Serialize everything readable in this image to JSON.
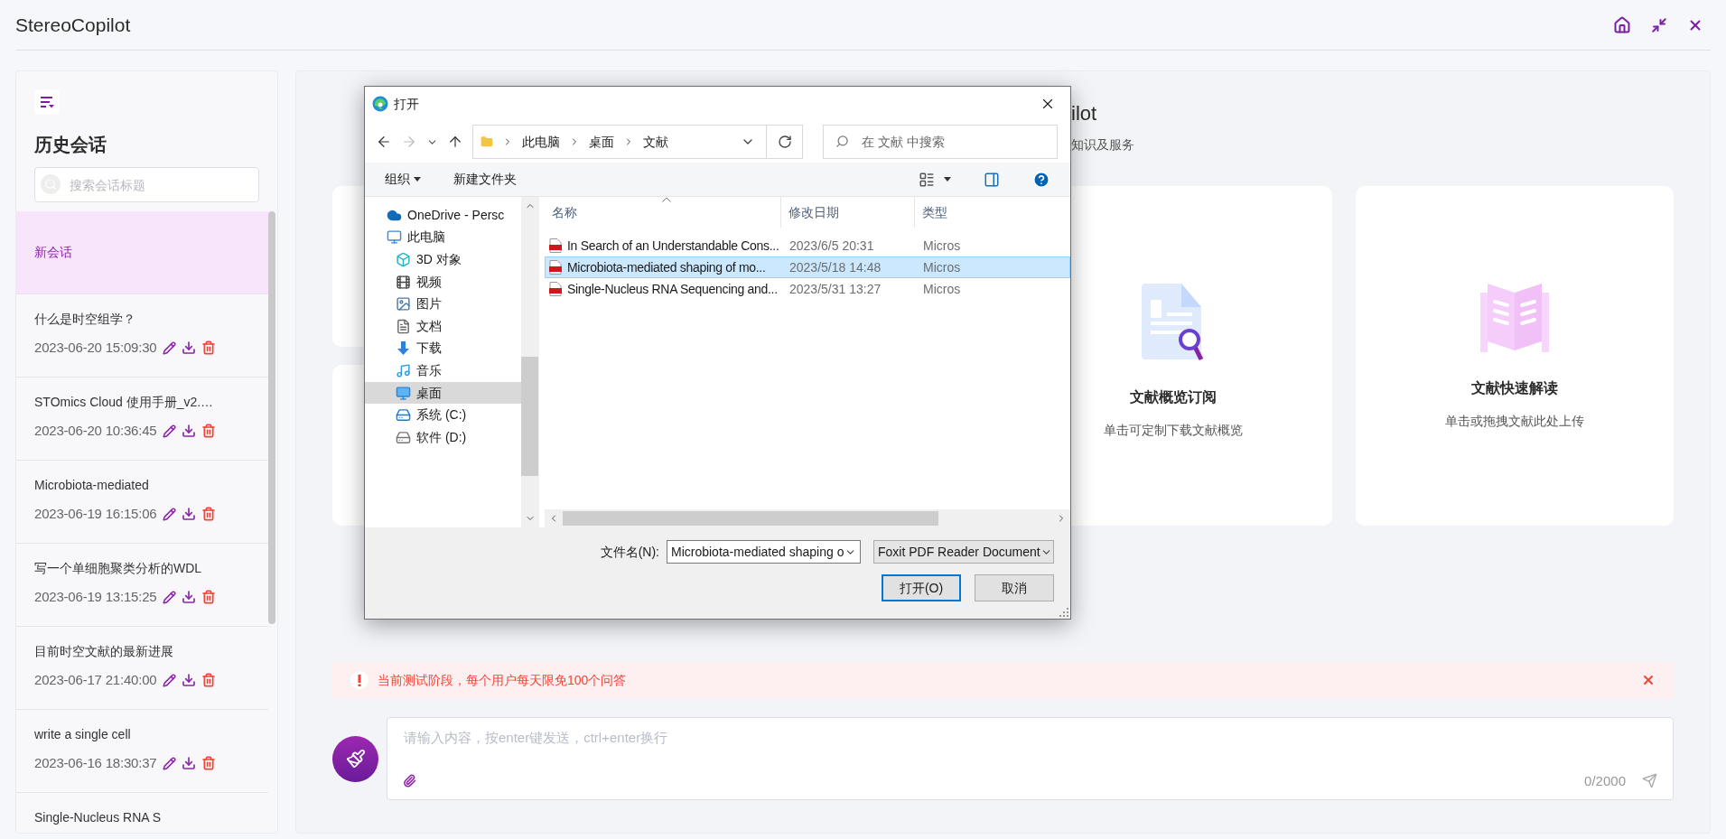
{
  "app": {
    "title": "StereoCopilot"
  },
  "sidebar": {
    "heading": "历史会话",
    "search": {
      "placeholder": "搜索会话标题"
    },
    "conversations": [
      {
        "title": "新会话",
        "selected": true
      },
      {
        "title": "什么是时空组学？",
        "time": "2023-06-20 15:09:30",
        "selected": false
      },
      {
        "title": "STOmics Cloud 使用手册_v2.…",
        "time": "2023-06-20 10:36:45",
        "selected": false
      },
      {
        "title": "Microbiota-mediated",
        "time": "2023-06-19 16:15:06",
        "selected": false
      },
      {
        "title": "写一个单细胞聚类分析的WDL",
        "time": "2023-06-19 13:15:25",
        "selected": false
      },
      {
        "title": "目前时空文献的最新进展",
        "time": "2023-06-17 21:40:00",
        "selected": false
      },
      {
        "title": "write a single cell",
        "time": "2023-06-16 18:30:37",
        "selected": false
      },
      {
        "title": "Single-Nucleus RNA S",
        "selected": false
      }
    ]
  },
  "main": {
    "title": "ilot",
    "subtitle": "知识及服务",
    "cards": [
      {
        "kind": "overview",
        "title": "文献概览订阅",
        "description": "单击可定制下载文献概览"
      },
      {
        "kind": "reader",
        "title": "文献快速解读",
        "description": "单击或拖拽文献此处上传"
      }
    ],
    "notice": {
      "text": "当前测试阶段，每个用户每天限免100个问答"
    },
    "composer": {
      "placeholder": "请输入内容，按enter键发送，ctrl+enter换行",
      "counter": "0/2000"
    }
  },
  "dialog": {
    "title": "打开",
    "path": [
      "此电脑",
      "桌面",
      "文献"
    ],
    "search": {
      "placeholder": "在 文献 中搜索"
    },
    "toolbar": {
      "organize": "组织",
      "new_folder": "新建文件夹"
    },
    "nav": [
      {
        "kind": "cloud",
        "label": "OneDrive - Persc",
        "selected": false
      },
      {
        "kind": "computer",
        "label": "此电脑",
        "selected": false,
        "children": [
          {
            "kind": "cube",
            "label": "3D 对象",
            "selected": false
          },
          {
            "kind": "video",
            "label": "视频",
            "selected": false
          },
          {
            "kind": "pictures",
            "label": "图片",
            "selected": false
          },
          {
            "kind": "documents",
            "label": "文档",
            "selected": false
          },
          {
            "kind": "downloads",
            "label": "下载",
            "selected": false
          },
          {
            "kind": "music",
            "label": "音乐",
            "selected": false
          },
          {
            "kind": "desktop",
            "label": "桌面",
            "selected": true
          },
          {
            "kind": "system-drive",
            "label": "系统 (C:)",
            "selected": false
          },
          {
            "kind": "drive",
            "label": "软件 (D:)",
            "selected": false
          }
        ]
      }
    ],
    "columns": [
      "名称",
      "修改日期",
      "类型"
    ],
    "files": [
      {
        "name": "In Search of an Understandable Cons...",
        "modified": "2023/6/5 20:31",
        "type": "Micros",
        "selected": false
      },
      {
        "name": "Microbiota-mediated shaping of mo...",
        "modified": "2023/5/18 14:48",
        "type": "Micros",
        "selected": true
      },
      {
        "name": "Single-Nucleus RNA Sequencing and...",
        "modified": "2023/5/31 13:27",
        "type": "Micros",
        "selected": false
      }
    ],
    "filename_label": "文件名(N):",
    "filename": "Microbiota-mediated shaping o",
    "filetype": "Foxit PDF Reader Document",
    "buttons": [
      {
        "kind": "primary",
        "label": "打开(O)"
      },
      {
        "kind": "secondary",
        "label": "取消"
      }
    ]
  }
}
